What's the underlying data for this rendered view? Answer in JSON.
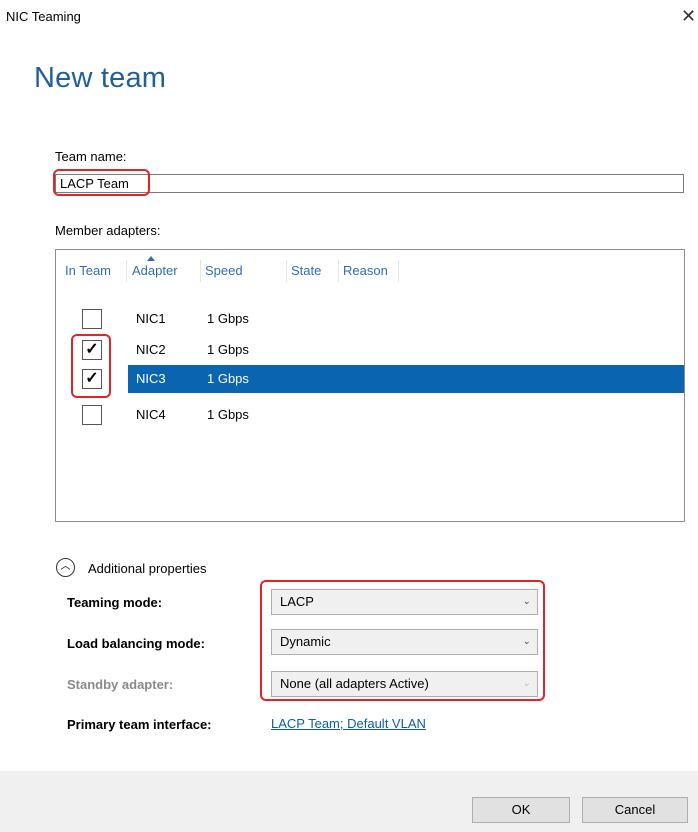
{
  "window": {
    "title": "NIC Teaming",
    "close_glyph": "✕"
  },
  "heading": "New team",
  "team_name": {
    "label": "Team name:",
    "value": "LACP Team"
  },
  "members": {
    "label": "Member adapters:",
    "columns": [
      "In Team",
      "Adapter",
      "Speed",
      "State",
      "Reason"
    ],
    "sorted_column": "Adapter",
    "rows": [
      {
        "checked": false,
        "adapter": "NIC1",
        "speed": "1 Gbps",
        "selected": false
      },
      {
        "checked": true,
        "adapter": "NIC2",
        "speed": "1 Gbps",
        "selected": false
      },
      {
        "checked": true,
        "adapter": "NIC3",
        "speed": "1 Gbps",
        "selected": true
      },
      {
        "checked": false,
        "adapter": "NIC4",
        "speed": "1 Gbps",
        "selected": false
      }
    ]
  },
  "additional": {
    "label": "Additional properties",
    "toggle_glyph": "︿",
    "teaming_mode": {
      "label": "Teaming mode:",
      "value": "LACP"
    },
    "load_balancing": {
      "label": "Load balancing mode:",
      "value": "Dynamic"
    },
    "standby": {
      "label": "Standby adapter:",
      "value": "None (all adapters Active)"
    },
    "primary": {
      "label": "Primary team interface:",
      "link": "LACP Team; Default VLAN"
    }
  },
  "buttons": {
    "ok": "OK",
    "cancel": "Cancel"
  },
  "icons": {
    "close": "close-icon",
    "collapse": "chevron-up-icon",
    "dropdown": "chevron-down-icon",
    "check": "checkmark-icon",
    "sort": "sort-ascending-icon"
  },
  "colors": {
    "accent": "#0a64b0",
    "heading": "#1f5f9e",
    "highlight": "#e0242a",
    "link": "#0b5cad"
  }
}
